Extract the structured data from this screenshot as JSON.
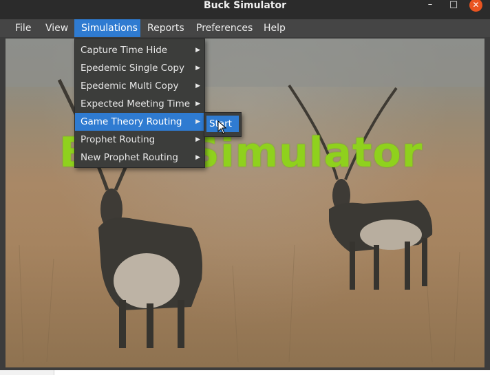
{
  "window": {
    "title": "Buck Simulator",
    "controls": {
      "minimize": "–",
      "maximize": "□",
      "close": "✕"
    }
  },
  "menubar": {
    "items": [
      {
        "label": "File"
      },
      {
        "label": "View"
      },
      {
        "label": "Simulations",
        "active": true
      },
      {
        "label": "Reports"
      },
      {
        "label": "Preferences"
      },
      {
        "label": "Help"
      }
    ]
  },
  "simulations_menu": {
    "items": [
      {
        "label": "Capture Time Hide"
      },
      {
        "label": "Epedemic Single Copy"
      },
      {
        "label": "Epedemic Multi Copy"
      },
      {
        "label": "Expected Meeting Time"
      },
      {
        "label": "Game Theory Routing",
        "active": true
      },
      {
        "label": "Prophet Routing"
      },
      {
        "label": "New Prophet Routing"
      }
    ],
    "submenu_arrow": "▶"
  },
  "submenu": {
    "items": [
      {
        "label": "Start"
      }
    ]
  },
  "background": {
    "title": "Buck Simulator"
  },
  "colors": {
    "accent": "#2f7bd1",
    "title_green": "#8fd11d",
    "close": "#e95420"
  }
}
